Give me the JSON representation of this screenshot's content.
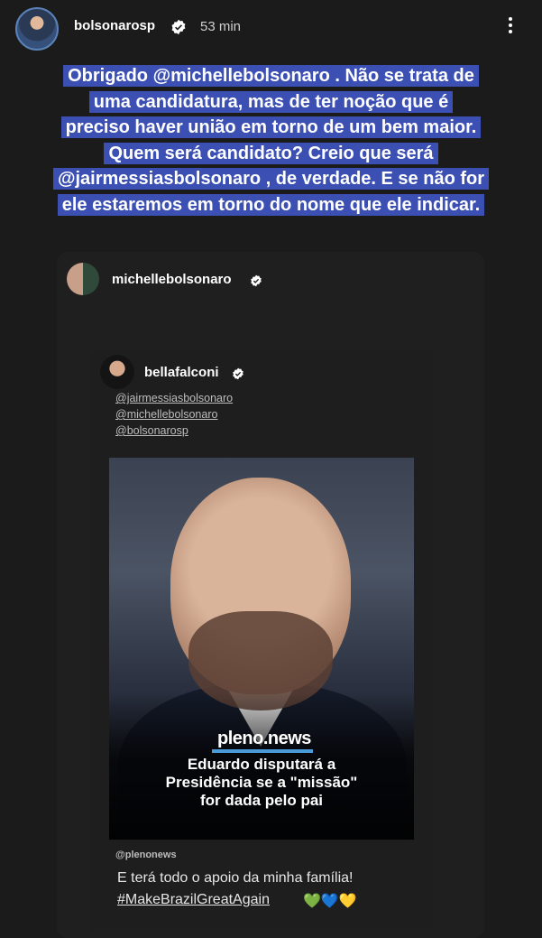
{
  "header": {
    "username": "bolsonarosp",
    "time": "53 min"
  },
  "caption": {
    "line1_a": "Obrigado ",
    "line1_mention": "@michellebolsonaro",
    "line1_b": " . Não se trata de",
    "line2": "uma candidatura, mas de ter noção que é",
    "line3": "preciso haver união em torno de um bem maior.",
    "line4": "Quem será candidato? Creio que será",
    "line5_mention": "@jairmessiasbolsonaro",
    "line5_b": " , de verdade. E se não for",
    "line6": "ele estaremos em torno do nome que ele indicar."
  },
  "shared_post": {
    "username": "michellebolsonaro"
  },
  "inner_post": {
    "username": "bellafalconi",
    "tags": [
      "@jairmessiasbolsonaro",
      "@michellebolsonaro",
      "@bolsonarosp"
    ],
    "brand": "pleno.news",
    "headline_1": "Eduardo disputará a",
    "headline_2": "Presidência se a \"missão\"",
    "headline_3": "for dada pelo pai",
    "credit": "@plenonews",
    "caption": "E terá todo o apoio da minha família!",
    "hashtag": "#MakeBrazilGreatAgain",
    "hearts": "💚💙💛"
  },
  "colors": {
    "caption_highlight": "#3c50b4",
    "background": "#1b1b1b",
    "brand_accent": "#4a9bd8"
  },
  "icons": [
    "verified-badge-icon",
    "more-options-icon"
  ]
}
